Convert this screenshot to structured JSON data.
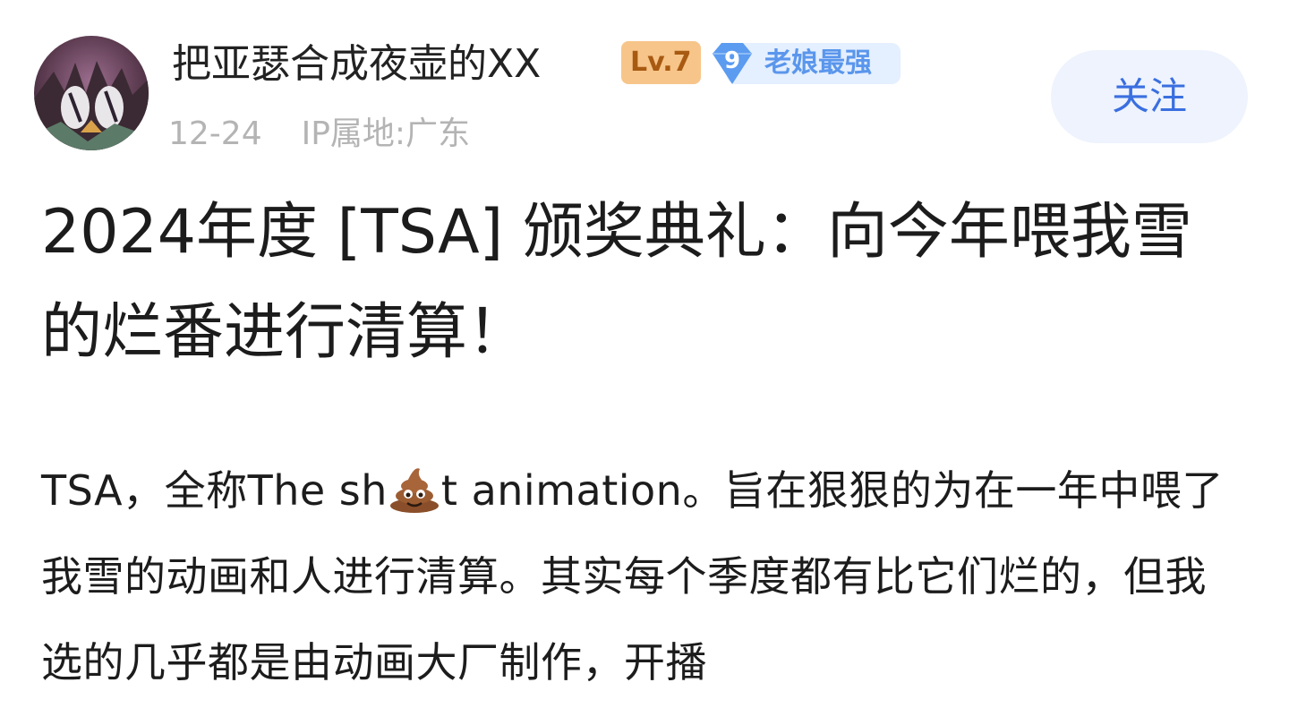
{
  "author": {
    "username": "把亚瑟合成夜壶的XX",
    "level": "Lv.7",
    "fan_badge": {
      "level": "9",
      "label": "老娘最强"
    },
    "date": "12-24",
    "ip_location": "IP属地:广东"
  },
  "actions": {
    "follow_label": "关注"
  },
  "post": {
    "title": "2024年度 [TSA] 颁奖典礼：向今年喂我雪的烂番进行清算！",
    "body_part1": "TSA，全称The sh",
    "body_emoji_icon": "poop-emoji-icon",
    "body_part2": "t animation。旨在狠狠的为在一年中喂了我雪的动画和人进行清算。其实每个季度都有比它们烂的，但我选的几乎都是由动画大厂制作，开播"
  },
  "colors": {
    "accent_blue": "#3a6fe0",
    "follow_bg": "#eef3fd",
    "level_badge_bg": "#f7c58a",
    "fan_badge_bg": "#e4efff",
    "meta_gray": "#b4b4b4"
  }
}
